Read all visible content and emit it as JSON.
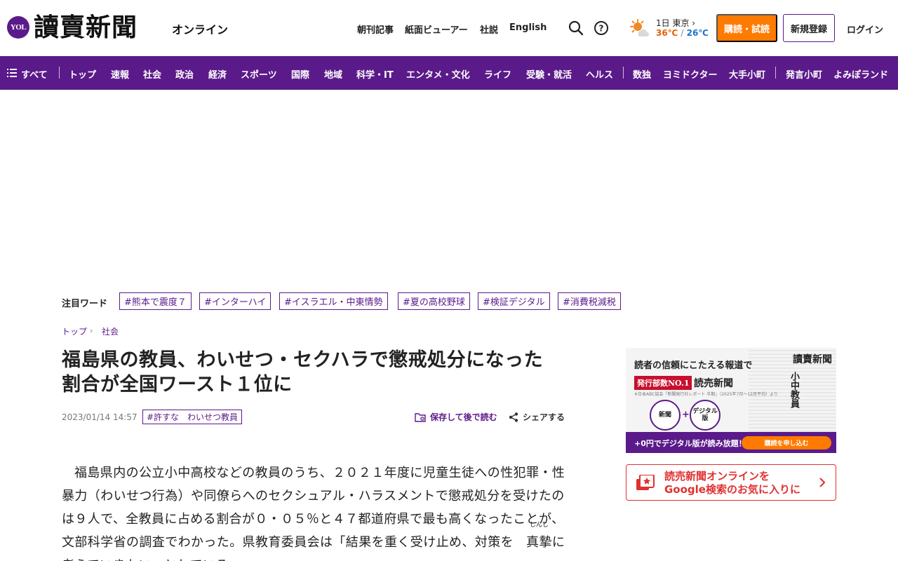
{
  "header": {
    "logo_badge": "YOL",
    "logo_title": "讀賣新聞",
    "logo_sub": "オンライン",
    "nav": [
      "朝刊記事",
      "紙面ビューアー",
      "社説",
      "English"
    ],
    "weather": {
      "date": "1日 東京",
      "high": "36℃",
      "sep": "/",
      "low": "26℃"
    },
    "subscribe_label": "購読・試読",
    "register_label": "新規登録",
    "login_label": "ログイン"
  },
  "categories": {
    "all_label": "すべて",
    "items": [
      "トップ",
      "速報",
      "社会",
      "政治",
      "経済",
      "スポーツ",
      "国際",
      "地域",
      "科学・IT",
      "エンタメ・文化",
      "ライフ",
      "受験・就活",
      "ヘルス"
    ],
    "extra": [
      "数独",
      "ヨミドクター",
      "大手小町"
    ],
    "extra2": [
      "発言小町",
      "よみぽランド"
    ]
  },
  "trending": {
    "label": "注目ワード",
    "tags": [
      "#熊本で震度７",
      "#インターハイ",
      "#イスラエル・中東情勢",
      "#夏の高校野球",
      "#検証デジタル",
      "#消費税減税"
    ]
  },
  "breadcrumb": [
    "トップ",
    "社会"
  ],
  "article": {
    "headline_1": "福島県の教員、わいせつ・セクハラで懲戒処分になった",
    "headline_2": "割合が全国ワースト１位に",
    "date": "2023/01/14 14:57",
    "tag": "#許すな　わいせつ教員",
    "save_label": "保存して後で読む",
    "share_label": "シェアする",
    "body_before": "福島県内の公立小中高校などの教員のうち、２０２１年度に児童生徒への性犯罪・性暴力（わいせつ行為）や同僚らへのセクシュアル・ハラスメントで懲戒処分を受けたのは９人で、全教員に占める割合が０・０５％と４７都道府県で最も高くなったことが、文部科学省の調査でわかった。県教育委員会は「結果を重く受け止め、対策を",
    "ruby_base": "真摯",
    "ruby_text": "しんし",
    "body_after": "に考えていきたい」としている。"
  },
  "sidebar_ad": {
    "headline": "読者の信頼にこたえる報道で",
    "badge": "発行部数NO.1",
    "brand": "読売新聞",
    "footnote": "※日本ABC協会「新聞発行社レポート 半期」（2025年7月〜12月平均）より",
    "circle_1": "新聞",
    "circle_2": "デジタル版",
    "paper_title": "讀賣新聞",
    "paper_headline": "小中教員",
    "bottom_text": "+0円でデジタル版が読み放題！",
    "cta": "購読を申し込む"
  },
  "google_fav": {
    "line_1": "読売新聞オンラインを",
    "line_2": "Google検索のお気に入りに"
  },
  "colors": {
    "brand": "#5b1a8a",
    "accent": "#ff7a00",
    "google_red": "#e0312f"
  }
}
